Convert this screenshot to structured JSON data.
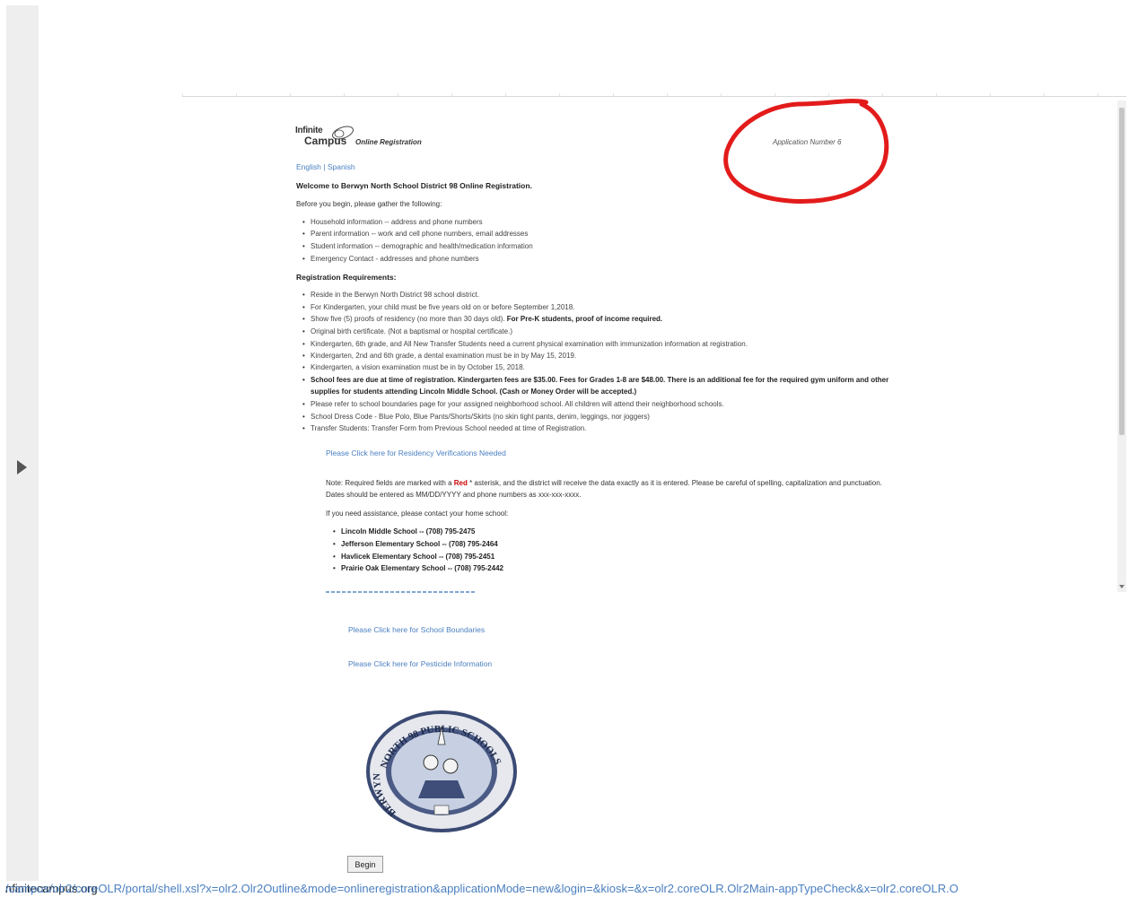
{
  "header": {
    "logo_line1": "Infinite",
    "logo_line2": "Campus",
    "logo_tag": "Online Registration",
    "application_number": "Application Number 6"
  },
  "lang": {
    "english": "English",
    "separator": " | ",
    "spanish": "Spanish"
  },
  "intro": {
    "welcome": "Welcome to Berwyn North School District 98 Online Registration.",
    "gather": "Before you begin, please gather the following:",
    "items": [
      "Household information -- address and phone numbers",
      "Parent information -- work and cell phone numbers, email addresses",
      "Student information -- demographic and health/medication information",
      "Emergency Contact - addresses and phone numbers"
    ]
  },
  "requirements": {
    "heading": "Registration Requirements:",
    "r1": "Reside in the Berwyn North District 98 school district.",
    "r2": "For Kindergarten, your child must be five years old on or before September 1,2018.",
    "r3a": "Show five (5) proofs of residency (no more than 30 days old). ",
    "r3b": "For Pre-K students, proof of income required.",
    "r4": "Original birth certificate. (Not a baptismal or hospital certificate.)",
    "r5": "Kindergarten, 6th grade, and All New Transfer Students need a current physical examination with immunization information at registration.",
    "r6": "Kindergarten, 2nd and 6th grade, a dental examination must be in by May 15, 2019.",
    "r7": "Kindergarten, a vision examination must be in by October 15, 2018.",
    "r8a": "School fees are due at time of registration. Kindergarten fees are $35.00. Fees for Grades 1-8 are $48.00. There is an additional fee for the required gym uniform and other",
    "r8b": "supplies for students attending Lincoln Middle School. (Cash or Money Order will be accepted.)",
    "r9": "Please refer to school boundaries page for your assigned neighborhood school. All children will attend their neighborhood schools.",
    "r10": "School Dress Code - Blue Polo, Blue Pants/Shorts/Skirts (no skin tight pants, denim, leggings, nor joggers)",
    "r11": "Transfer Students: Transfer Form from Previous School needed at time of Registration."
  },
  "links": {
    "residency": "Please Click here for Residency Verifications Needed",
    "boundaries": "Please Click here for School Boundaries",
    "pesticide": "Please Click here for Pesticide Information"
  },
  "note": {
    "pre": "Note: Required fields are marked with a ",
    "red": "Red",
    "post": " * asterisk, and the district will receive the data exactly as it is entered. Please be careful of spelling, capitalization and punctuation.",
    "line2": "Dates should be entered as MM/DD/YYYY and phone numbers as xxx-xxx-xxxx.",
    "assist": "If you need assistance, please contact your home school:"
  },
  "schools": [
    "Lincoln Middle School -- (708) 795-2475",
    "Jefferson Elementary School -- (708) 795-2464",
    "Havlicek Elementary School -- (708) 795-2451",
    "Prairie Oak Elementary School -- (708) 795-2442"
  ],
  "seal": {
    "top_text": "NORTH 98 PUBLIC SCHOOLS",
    "left_text": "BERWYN"
  },
  "buttons": {
    "begin": "Begin"
  },
  "status_bar": {
    "host": "nfinitecampus.org",
    "path": "/campus/olr2/coreOLR/portal/shell.xsl?x=olr2.Olr2Outline&mode=onlineregistration&applicationMode=new&login=&kiosk=&x=olr2.coreOLR.Olr2Main-appTypeCheck&x=olr2.coreOLR.O"
  },
  "colors": {
    "link": "#4a7fc1",
    "annotation": "#e31b1b",
    "required": "#cc0000"
  }
}
